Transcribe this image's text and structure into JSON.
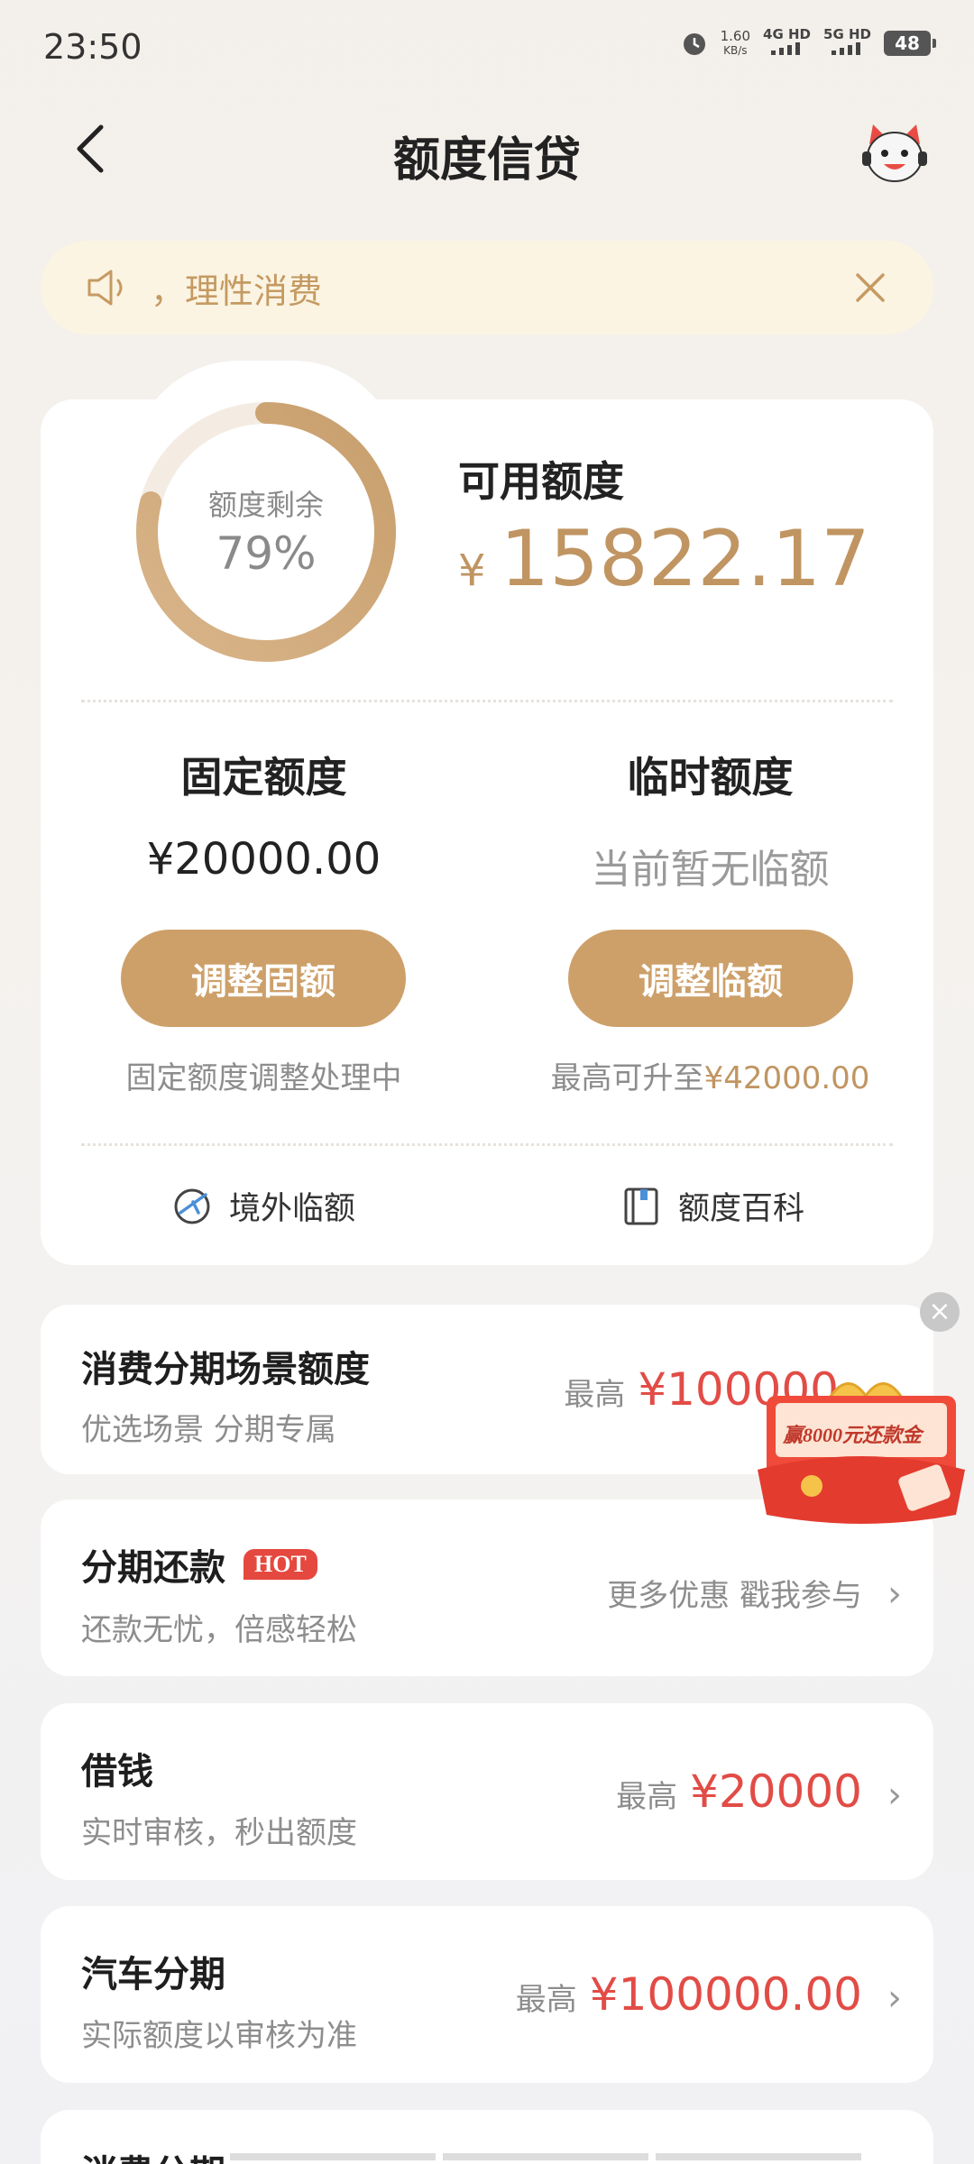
{
  "status_bar": {
    "time": "23:50",
    "speed_value": "1.60",
    "speed_unit": "KB/s",
    "net1": "4G HD",
    "net2": "5G HD",
    "battery": "48"
  },
  "header": {
    "title": "额度信贷"
  },
  "notice": {
    "text": "，理性消费"
  },
  "credit": {
    "gauge_label": "额度剩余",
    "gauge_percent_text": "79%",
    "gauge_fraction": 0.79,
    "available_label": "可用额度",
    "available_currency": "¥",
    "available_amount": "15822.17",
    "fixed": {
      "title": "固定额度",
      "value": "¥20000.00",
      "button": "调整固额",
      "note": "固定额度调整处理中"
    },
    "temp": {
      "title": "临时额度",
      "value": "当前暂无临额",
      "button": "调整临额",
      "note_prefix": "最高可升至",
      "note_amount": "¥42000.00"
    },
    "tools": {
      "overseas": "境外临额",
      "wiki": "额度百科"
    }
  },
  "list": [
    {
      "title": "消费分期场景额度",
      "subtitle": "优选场景 分期专属",
      "prefix": "最高",
      "amount": "¥100000"
    },
    {
      "title": "分期还款",
      "badge": "HOT",
      "subtitle": "还款无忧，倍感轻松",
      "prefix": "更多优惠 戳我参与",
      "amount": ""
    },
    {
      "title": "借钱",
      "subtitle": "实时审核，秒出额度",
      "prefix": "最高",
      "amount": "¥20000"
    },
    {
      "title": "汽车分期",
      "subtitle": "实际额度以审核为准",
      "prefix": "最高",
      "amount": "¥100000.00"
    },
    {
      "title": "消费分期",
      "subtitle": "",
      "prefix": "",
      "amount": ""
    }
  ],
  "promo": {
    "text": "赢8000元还款金"
  },
  "colors": {
    "gold": "#c09562",
    "button_gold": "#cda06a",
    "red": "#e24c46",
    "notice_bg": "#fbf4e3"
  }
}
